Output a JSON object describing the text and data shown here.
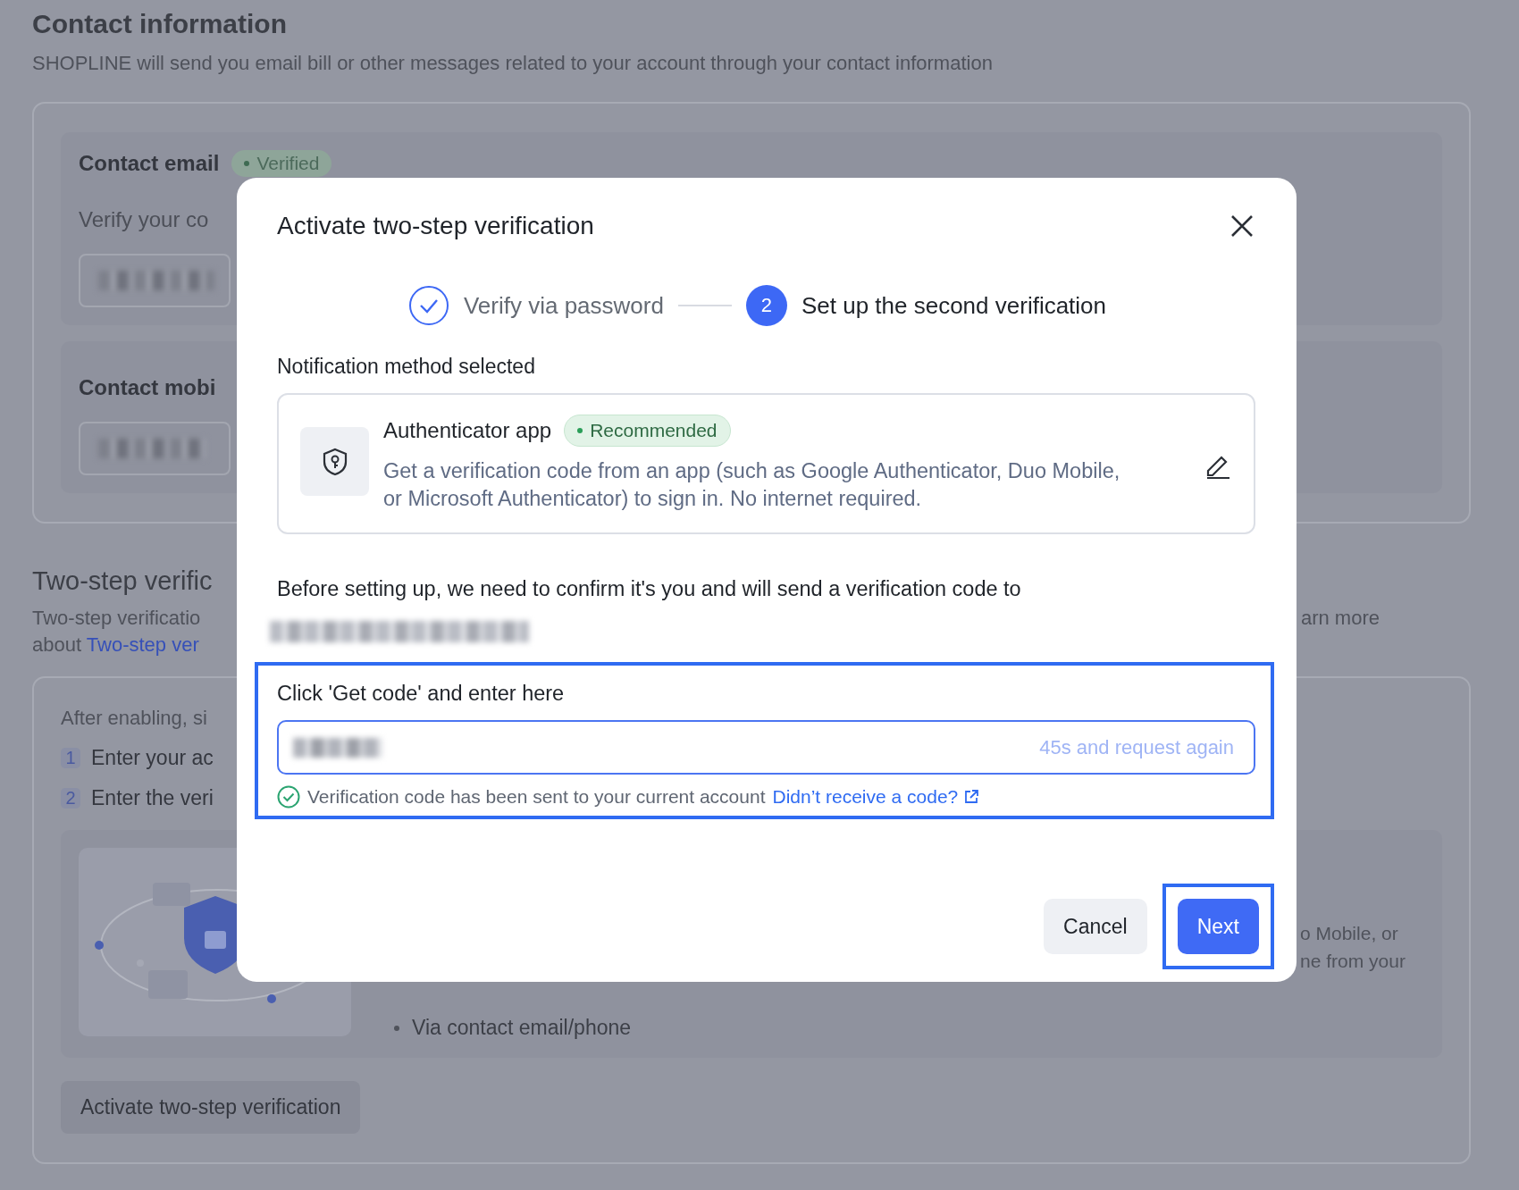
{
  "background": {
    "title": "Contact information",
    "subtitle": "SHOPLINE will send you email bill or other messages related to your account through your contact information",
    "contact_email": {
      "label": "Contact email",
      "badge": "Verified",
      "hint": "Verify your co"
    },
    "contact_mobile": {
      "label": "Contact mobi"
    },
    "two_step": {
      "title": "Two-step verific",
      "desc_start": "Two-step verificatio",
      "desc_end": "arn more",
      "desc_about": "about ",
      "desc_link": "Two-step ver",
      "intro": "After enabling, si",
      "steps": [
        {
          "number": "1",
          "text": "Enter your ac"
        },
        {
          "number": "2",
          "text": "Enter the veri"
        }
      ],
      "detail_fragments": [
        "o Mobile, or",
        "ne from your"
      ],
      "bullet": "Via contact email/phone",
      "button": "Activate two-step verification"
    }
  },
  "dialog": {
    "title": "Activate two-step verification",
    "steps": [
      {
        "label": "Verify via password",
        "done": true,
        "selected": false
      },
      {
        "number": "2",
        "label": "Set up the second verification",
        "done": false,
        "selected": true
      }
    ],
    "method_label": "Notification method selected",
    "method": {
      "name": "Authenticator app",
      "badge": "Recommended",
      "description": "Get a verification code from an app (such as Google Authenticator, Duo Mobile, or Microsoft Authenticator) to sign in. No internet required."
    },
    "confirm_text": "Before setting up, we need to confirm it's you and will send a verification code to",
    "code_field": {
      "label": "Click 'Get code' and enter here",
      "countdown": "45s and request again",
      "highlighted": true
    },
    "sent_message": "Verification code has been sent to your current account",
    "help_link": "Didn’t receive a code?",
    "buttons": [
      {
        "label": "Cancel",
        "kind": "secondary",
        "highlighted": false
      },
      {
        "label": "Next",
        "kind": "primary",
        "highlighted": true
      }
    ]
  }
}
